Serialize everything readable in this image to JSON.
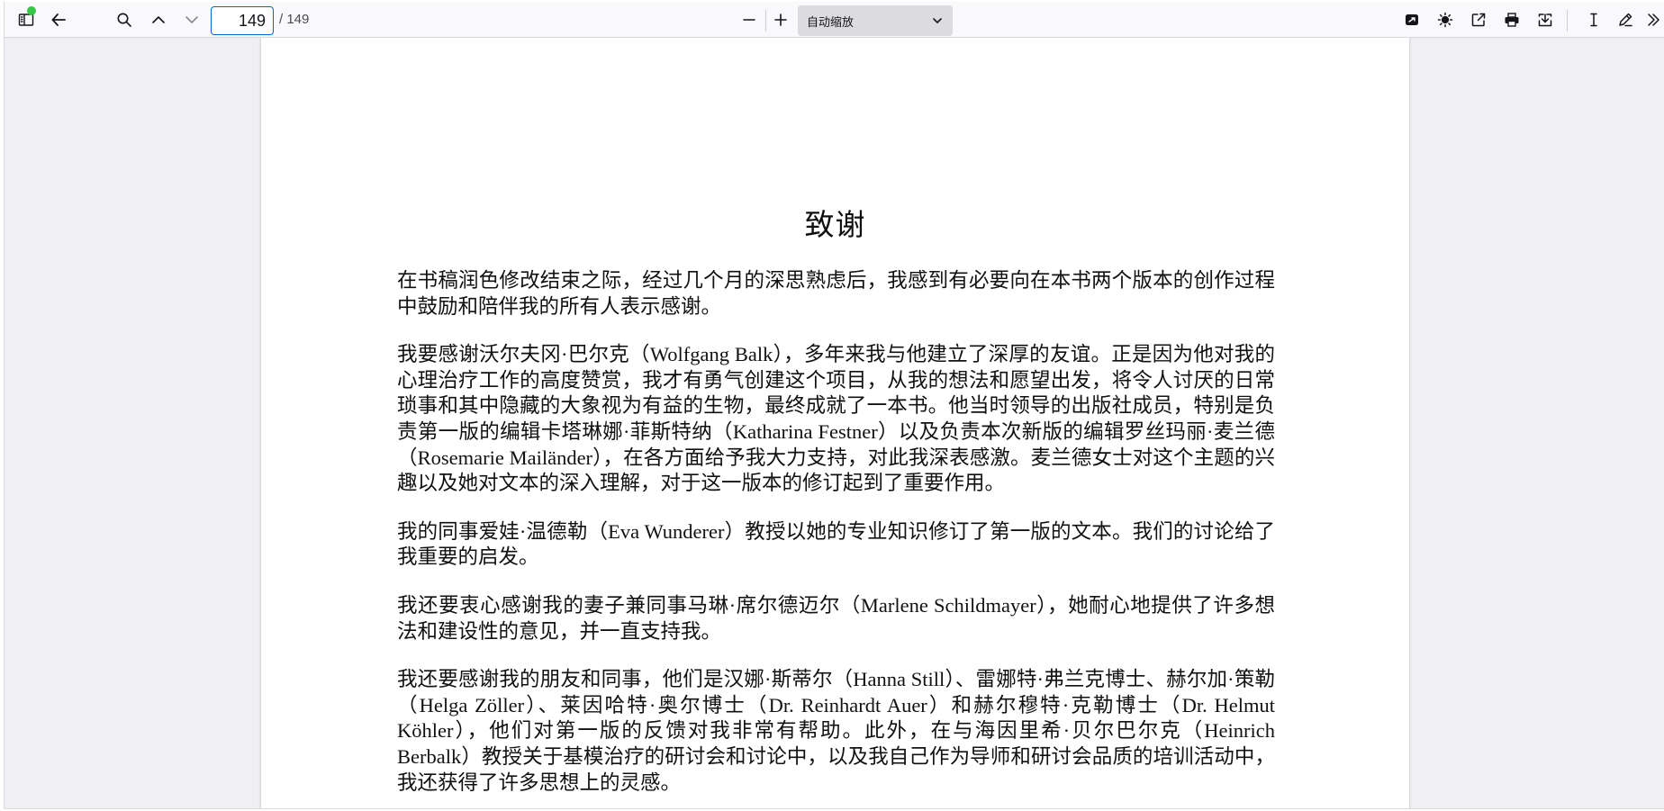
{
  "toolbar": {
    "current_page": "149",
    "total_pages": "/ 149",
    "zoom_label": "自动缩放",
    "icons": {
      "sidebar": "sidebar-toggle-icon",
      "back": "arrow-left-icon",
      "search": "search-icon",
      "prev": "chevron-up-icon",
      "next": "chevron-down-icon",
      "zoom_out": "minus-icon",
      "zoom_in": "plus-icon",
      "presentation": "presentation-icon",
      "theme": "sun-icon",
      "open": "open-external-icon",
      "print": "printer-icon",
      "download": "download-icon",
      "text_tool": "text-cursor-icon",
      "draw_tool": "pen-icon",
      "more": "double-chevron-right-icon"
    },
    "colors": {
      "status_dot": "#37c748",
      "input_border": "#0b62d8"
    }
  },
  "document": {
    "title": "致谢",
    "paragraphs": [
      "在书稿润色修改结束之际，经过几个月的深思熟虑后，我感到有必要向在本书两个版本的创作过程中鼓励和陪伴我的所有人表示感谢。",
      "我要感谢沃尔夫冈·巴尔克（Wolfgang Balk），多年来我与他建立了深厚的友谊。正是因为他对我的心理治疗工作的高度赞赏，我才有勇气创建这个项目，从我的想法和愿望出发，将令人讨厌的日常琐事和其中隐藏的大象视为有益的生物，最终成就了一本书。他当时领导的出版社成员，特别是负责第一版的编辑卡塔琳娜·菲斯特纳（Katharina Festner）以及负责本次新版的编辑罗丝玛丽·麦兰德（Rosemarie Mailänder），在各方面给予我大力支持，对此我深表感激。麦兰德女士对这个主题的兴趣以及她对文本的深入理解，对于这一版本的修订起到了重要作用。",
      "我的同事爱娃·温德勒（Eva Wunderer）教授以她的专业知识修订了第一版的文本。我们的讨论给了我重要的启发。",
      "我还要衷心感谢我的妻子兼同事马琳·席尔德迈尔（Marlene Schildmayer），她耐心地提供了许多想法和建设性的意见，并一直支持我。",
      "我还要感谢我的朋友和同事，他们是汉娜·斯蒂尔（Hanna Still）、雷娜特·弗兰克博士、赫尔加·策勒（Helga Zöller）、莱因哈特·奥尔博士（Dr. Reinhardt Auer）和赫尔穆特·克勒博士（Dr. Helmut Köhler），他们对第一版的反馈对我非常有帮助。此外，在与海因里希·贝尔巴尔克（Heinrich Berbalk）教授关于基模治疗的研讨会和讨论中，以及我自己作为导师和研讨会品质的培训活动中，我还获得了许多思想上的灵感。"
    ]
  }
}
